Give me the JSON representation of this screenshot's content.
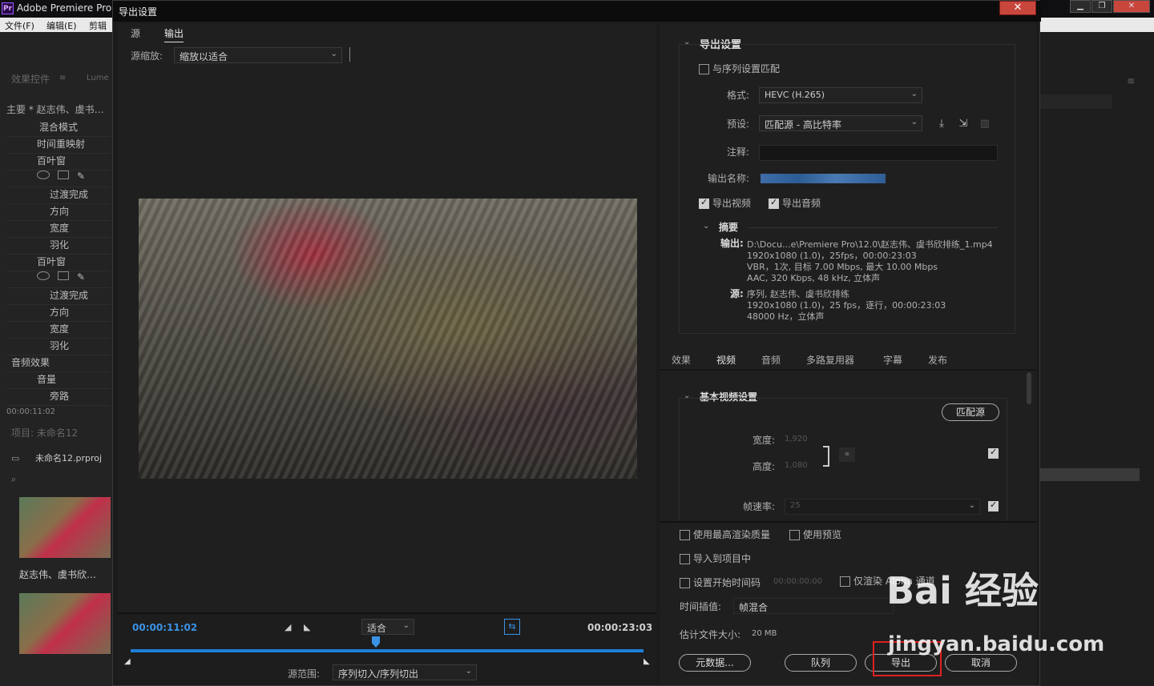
{
  "app": {
    "title": "Adobe Premiere Pro",
    "menu": [
      "文件(F)",
      "编辑(E)",
      "剪辑"
    ],
    "left_panel": {
      "tab1": "效果控件",
      "tab2": "Lume",
      "clip": "主要 * 赵志伟、虞书…",
      "rows": [
        "混合模式",
        "时间重映射",
        "百叶窗",
        "过渡完成",
        "方向",
        "宽度",
        "羽化",
        "百叶窗",
        "过渡完成",
        "方向",
        "宽度",
        "羽化",
        "音频效果",
        "音量",
        "旁路"
      ],
      "timecode": "00:00:11:02",
      "project_label": "项目: 未命名12",
      "project_file": "未命名12.prproj",
      "clip_name": "赵志伟、虞书欣…"
    }
  },
  "dialog": {
    "title": "导出设置",
    "close": "✕",
    "tabs": {
      "source": "源",
      "output": "输出"
    },
    "source_scale_label": "源缩放:",
    "source_scale_value": "缩放以适合",
    "timecode_in": "00:00:11:02",
    "timecode_out": "00:00:23:03",
    "fit_value": "适合",
    "source_range_label": "源范围:",
    "source_range_value": "序列切入/序列切出",
    "export_settings": {
      "header": "导出设置",
      "match_sequence": "与序列设置匹配",
      "format_label": "格式:",
      "format_value": "HEVC (H.265)",
      "preset_label": "预设:",
      "preset_value": "匹配源 - 高比特率",
      "comment_label": "注释:",
      "output_name_label": "输出名称:",
      "export_video": "导出视频",
      "export_audio": "导出音频",
      "summary_header": "摘要",
      "output_label": "输出:",
      "output_lines": [
        "D:\\Docu...e\\Premiere Pro\\12.0\\赵志伟、虞书欣排练_1.mp4",
        "1920x1080 (1.0)，25fps，00:00:23:03",
        "VBR，1次, 目标 7.00 Mbps, 最大 10.00 Mbps",
        "AAC, 320 Kbps, 48 kHz, 立体声"
      ],
      "source_label": "源:",
      "source_lines": [
        "序列, 赵志伟、虞书欣排练",
        "1920x1080 (1.0)，25 fps，逐行，00:00:23:03",
        "48000 Hz，立体声"
      ]
    },
    "right_tabs": [
      "效果",
      "视频",
      "音频",
      "多路复用器",
      "字幕",
      "发布"
    ],
    "basic_video": {
      "header": "基本视频设置",
      "match_source": "匹配源",
      "width_label": "宽度:",
      "width_value": "1,920",
      "height_label": "高度:",
      "height_value": "1,080",
      "fps_label": "帧速率:",
      "fps_value": "25"
    },
    "bottom": {
      "max_render": "使用最高渲染质量",
      "use_preview": "使用预览",
      "import_project": "导入到项目中",
      "set_start_tc": "设置开始时间码",
      "start_tc_value": "00:00:00:00",
      "alpha_only": "仅渲染 Alpha 通道",
      "interp_label": "时间插值:",
      "interp_value": "帧混合",
      "file_size_label": "估计文件大小:",
      "file_size_value": "20 MB",
      "metadata": "元数据...",
      "queue": "队列",
      "export": "导出",
      "cancel": "取消"
    }
  },
  "watermark": {
    "line1": "Bai 经验",
    "line2": "jingyan.baidu.com"
  },
  "colors": {
    "accent_blue": "#3b93e6",
    "highlight_red": "#e02020"
  }
}
